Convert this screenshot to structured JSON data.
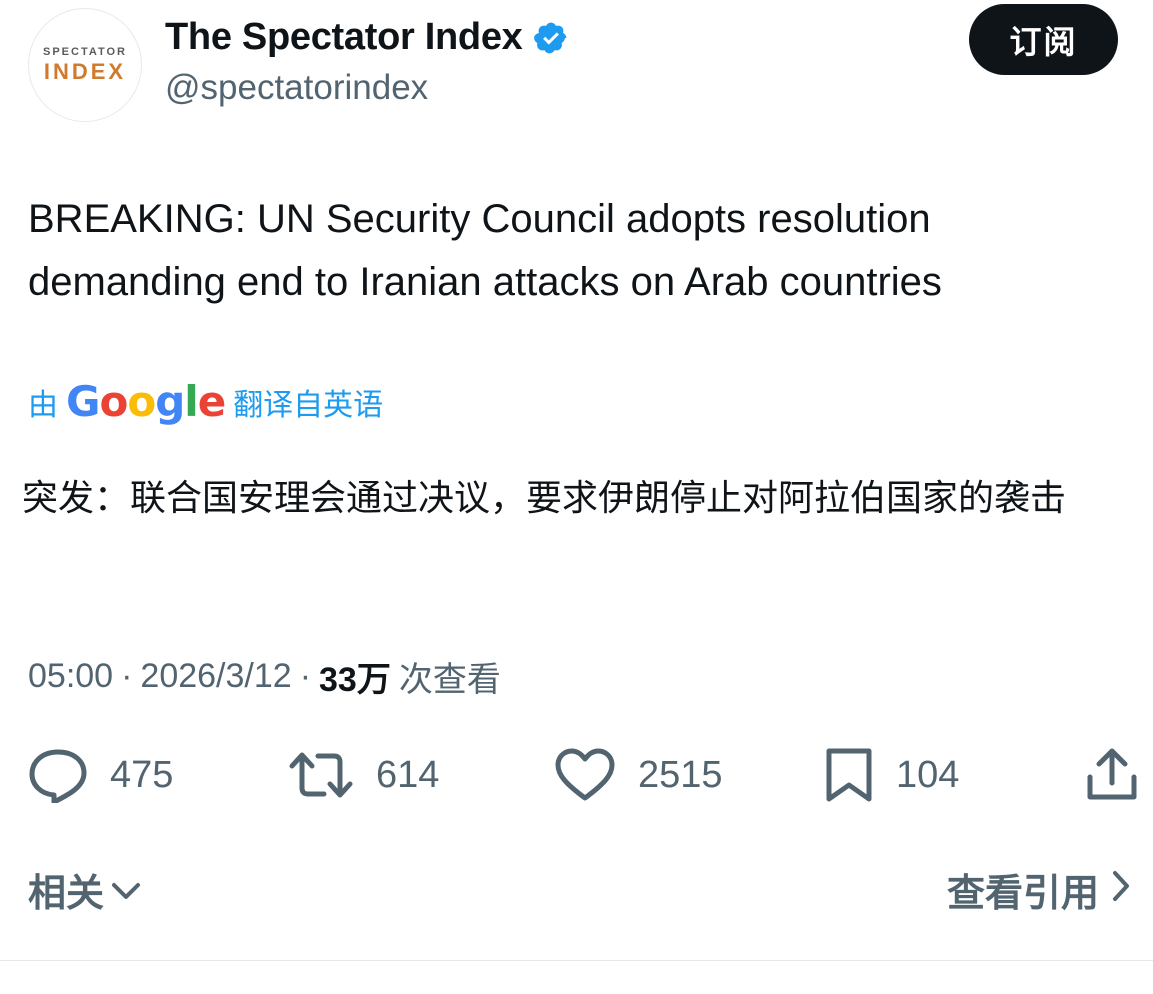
{
  "author": {
    "display_name": "The Spectator Index",
    "handle": "@spectatorindex",
    "verified": true,
    "avatar_top": "SPECTATOR",
    "avatar_bottom": "INDEX"
  },
  "subscribe_label": "订阅",
  "tweet_text": "BREAKING: UN Security Council adopts resolution demanding end to Iranian attacks on Arab countries",
  "translation": {
    "prefix": "由",
    "provider": "Google",
    "suffix": "翻译自英语",
    "text": "突发：联合国安理会通过决议，要求伊朗停止对阿拉伯国家的袭击"
  },
  "meta": {
    "time": "05:00",
    "date": "2026/3/12",
    "views_count": "33万",
    "views_label": "次查看"
  },
  "actions": {
    "replies": "475",
    "retweets": "614",
    "likes": "2515",
    "bookmarks": "104"
  },
  "footer": {
    "related_label": "相关",
    "quotes_label": "查看引用"
  },
  "colors": {
    "accent": "#1d9bf0",
    "text": "#0f1419",
    "muted": "#536471",
    "avatar_orange": "#d07a2e"
  }
}
